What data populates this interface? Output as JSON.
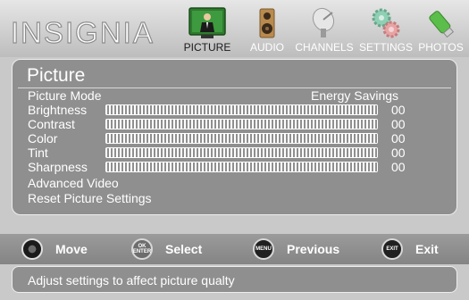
{
  "header": {
    "logo": "INSIGNIA",
    "tabs": [
      {
        "label": "PICTURE",
        "icon": "tv-icon",
        "active": true
      },
      {
        "label": "AUDIO",
        "icon": "speaker-icon",
        "active": false
      },
      {
        "label": "CHANNELS",
        "icon": "satellite-dish-icon",
        "active": false
      },
      {
        "label": "SETTINGS",
        "icon": "gears-icon",
        "active": false
      },
      {
        "label": "PHOTOS",
        "icon": "usb-stick-icon",
        "active": false
      }
    ]
  },
  "main": {
    "title": "Picture",
    "items": [
      {
        "label": "Picture Mode",
        "value": "Energy Savings"
      },
      {
        "label": "Brightness",
        "value": "00",
        "level": 0
      },
      {
        "label": "Contrast",
        "value": "00",
        "level": 0
      },
      {
        "label": "Color",
        "value": "00",
        "level": 0
      },
      {
        "label": "Tint",
        "value": "00",
        "level": 0
      },
      {
        "label": "Sharpness",
        "value": "00",
        "level": 0
      },
      {
        "label": "Advanced Video"
      },
      {
        "label": "Reset Picture Settings"
      }
    ]
  },
  "nav": {
    "move": {
      "label": "Move",
      "icon": "dpad-icon"
    },
    "select": {
      "label": "Select",
      "button": "OK\nENTER"
    },
    "previous": {
      "label": "Previous",
      "button": "MENU"
    },
    "exit": {
      "label": "Exit",
      "button": "EXIT"
    }
  },
  "help": "Adjust settings to affect picture qualty",
  "colors": {
    "panel": "#8f8f8f",
    "background": "#c9c9c9",
    "text": "#ffffff"
  }
}
